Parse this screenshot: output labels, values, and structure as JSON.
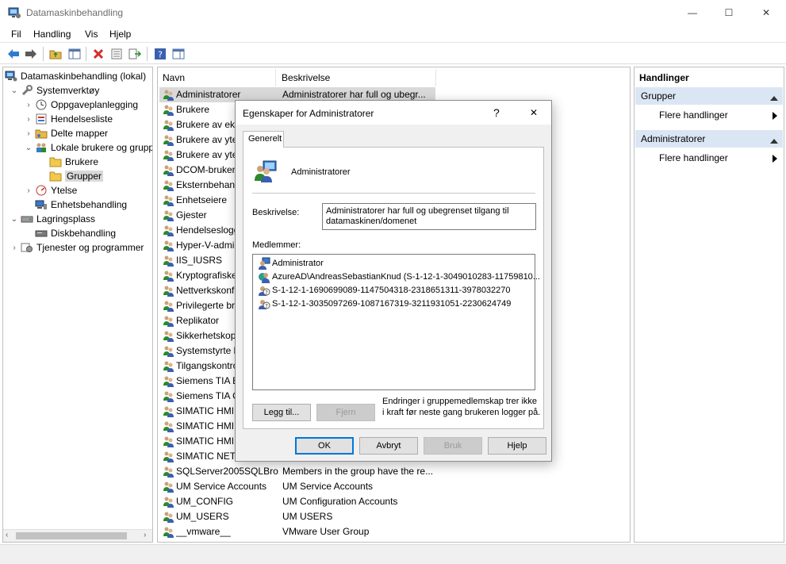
{
  "window": {
    "title": "Datamaskinbehandling",
    "minimize": "—",
    "maximize": "☐",
    "close": "✕",
    "icon": "computer-management-icon"
  },
  "menu": [
    "Fil",
    "Handling",
    "Vis",
    "Hjelp"
  ],
  "toolbar": {
    "buttons": [
      "back-icon",
      "forward-icon",
      "up-folder-icon",
      "show-hide-console-tree-icon",
      "delete-icon",
      "properties-icon",
      "export-list-icon",
      "help-icon",
      "show-hide-action-pane-icon"
    ]
  },
  "tree": {
    "items": [
      {
        "label": "Datamaskinbehandling (lokal)",
        "chevron": "",
        "icon": "computer-icon"
      },
      {
        "label": "Systemverktøy",
        "chevron": "⌄",
        "icon": "tools-icon"
      },
      {
        "label": "Oppgaveplanlegging",
        "chevron": "›",
        "icon": "clock-icon"
      },
      {
        "label": "Hendelsesliste",
        "chevron": "›",
        "icon": "event-viewer-icon"
      },
      {
        "label": "Delte mapper",
        "chevron": "›",
        "icon": "shared-folder-icon"
      },
      {
        "label": "Lokale brukere og grupper",
        "chevron": "⌄",
        "icon": "users-icon"
      },
      {
        "label": "Brukere",
        "chevron": "",
        "icon": "folder-icon"
      },
      {
        "label": "Grupper",
        "chevron": "",
        "icon": "folder-icon"
      },
      {
        "label": "Ytelse",
        "chevron": "›",
        "icon": "performance-icon"
      },
      {
        "label": "Enhetsbehandling",
        "chevron": "",
        "icon": "device-manager-icon"
      },
      {
        "label": "Lagringsplass",
        "chevron": "⌄",
        "icon": "storage-icon"
      },
      {
        "label": "Diskbehandling",
        "chevron": "",
        "icon": "disk-icon"
      },
      {
        "label": "Tjenester og programmer",
        "chevron": "›",
        "icon": "services-icon"
      }
    ]
  },
  "list": {
    "columns": [
      "Navn",
      "Beskrivelse"
    ],
    "rows": [
      {
        "name": "Administratorer",
        "desc": "Administratorer har full og ubegr..."
      },
      {
        "name": "Brukere",
        "desc": ""
      },
      {
        "name": "Brukere av eksternt",
        "desc": ""
      },
      {
        "name": "Brukere av ytelse",
        "desc": ""
      },
      {
        "name": "Brukere av ytelse",
        "desc": ""
      },
      {
        "name": "DCOM-brukere",
        "desc": ""
      },
      {
        "name": "Eksternbehandling",
        "desc": ""
      },
      {
        "name": "Enhetseiere",
        "desc": ""
      },
      {
        "name": "Gjester",
        "desc": ""
      },
      {
        "name": "Hendelsesloggl",
        "desc": ""
      },
      {
        "name": "Hyper-V-admin",
        "desc": ""
      },
      {
        "name": "IIS_IUSRS",
        "desc": ""
      },
      {
        "name": "Kryptografiske",
        "desc": ""
      },
      {
        "name": "Nettverkskonfi",
        "desc": ""
      },
      {
        "name": "Privilegerte brukere",
        "desc": ""
      },
      {
        "name": "Replikator",
        "desc": ""
      },
      {
        "name": "Sikkerhetskopi",
        "desc": ""
      },
      {
        "name": "Systemstyrte k",
        "desc": ""
      },
      {
        "name": "Tilgangskontroll",
        "desc": ""
      },
      {
        "name": "Siemens TIA Er",
        "desc": ""
      },
      {
        "name": "Siemens TIA O",
        "desc": ""
      },
      {
        "name": "SIMATIC HMI",
        "desc": ""
      },
      {
        "name": "SIMATIC HMI C",
        "desc": ""
      },
      {
        "name": "SIMATIC HMI V",
        "desc": ""
      },
      {
        "name": "SIMATIC NET",
        "desc": ""
      },
      {
        "name": "SQLServer2005SQLBro...",
        "desc": "Members in the group have the re..."
      },
      {
        "name": "UM Service Accounts",
        "desc": "UM Service Accounts"
      },
      {
        "name": "UM_CONFIG",
        "desc": "UM Configuration Accounts"
      },
      {
        "name": "UM_USERS",
        "desc": "UM USERS"
      },
      {
        "name": "__vmware__",
        "desc": "VMware User Group"
      }
    ]
  },
  "actions": {
    "header": "Handlinger",
    "sections": [
      {
        "title": "Grupper",
        "item": "Flere handlinger"
      },
      {
        "title": "Administratorer",
        "item": "Flere handlinger"
      }
    ]
  },
  "dialog": {
    "title": "Egenskaper for Administratorer",
    "help": "?",
    "close": "✕",
    "tab": "Generelt",
    "group_name": "Administratorer",
    "desc_label": "Beskrivelse:",
    "desc_value": "Administratorer har full og ubegrenset tilgang til datamaskinen/domenet",
    "members_label": "Medlemmer:",
    "members": [
      {
        "name": "Administrator",
        "icon": "user-icon"
      },
      {
        "name": "AzureAD\\AndreasSebastianKnud (S-1-12-1-3049010283-11759810...",
        "icon": "azure-user-icon"
      },
      {
        "name": "S-1-12-1-1690699089-1147504318-2318651311-3978032270",
        "icon": "unknown-user-icon"
      },
      {
        "name": "S-1-12-1-3035097269-1087167319-3211931051-2230624749",
        "icon": "unknown-user-icon"
      }
    ],
    "add_button": "Legg til...",
    "remove_button": "Fjern",
    "note": "Endringer i gruppemedlemskap trer ikke i kraft før neste gang brukeren logger på.",
    "ok": "OK",
    "cancel": "Avbryt",
    "apply": "Bruk",
    "help_button": "Hjelp"
  }
}
